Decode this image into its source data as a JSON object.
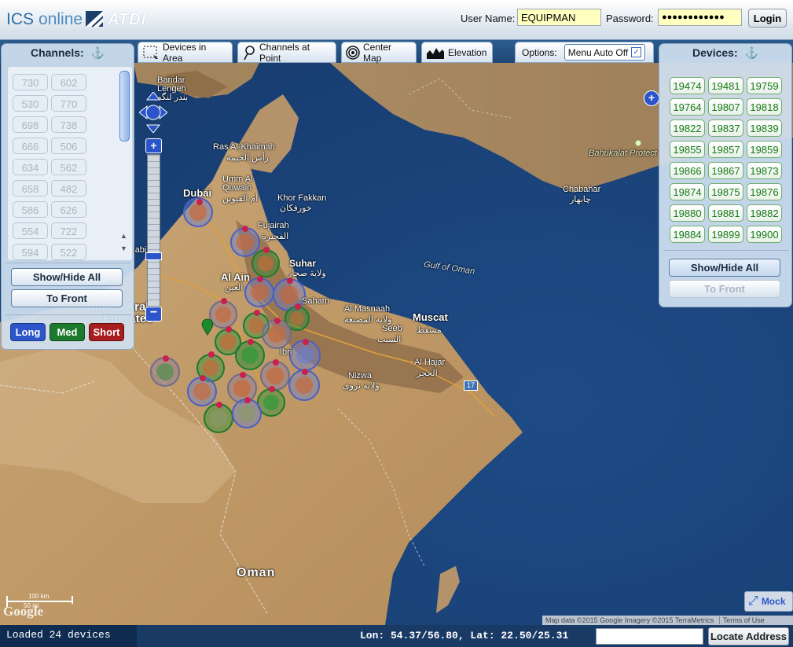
{
  "header": {
    "logo_ics": "ICS",
    "logo_online": "online",
    "logo_atdi": "ATDI",
    "username_label": "User Name:",
    "username_value": "EQUIPMAN",
    "password_label": "Password:",
    "password_value": "●●●●●●●●●●●●",
    "login_label": "Login"
  },
  "toolbar": {
    "devices_in_area": "Devices in Area",
    "channels_at_point": "Channels at Point",
    "center_map": "Center Map",
    "elevation": "Elevation",
    "options_label": "Options:",
    "menu_auto_off": "Menu Auto Off",
    "menu_auto_off_checked": true
  },
  "channels_panel": {
    "title": "Channels:",
    "channels": [
      "730",
      "602",
      "530",
      "770",
      "698",
      "738",
      "666",
      "506",
      "634",
      "562",
      "658",
      "482",
      "586",
      "626",
      "554",
      "722",
      "594",
      "522"
    ],
    "show_hide_all": "Show/Hide All",
    "to_front": "To Front",
    "range_long": "Long",
    "range_med": "Med",
    "range_short": "Short"
  },
  "devices_panel": {
    "title": "Devices:",
    "devices": [
      "19474",
      "19481",
      "19759",
      "19764",
      "19807",
      "19818",
      "19822",
      "19837",
      "19839",
      "19855",
      "19857",
      "19859",
      "19866",
      "19867",
      "19873",
      "19874",
      "19875",
      "19876",
      "19880",
      "19881",
      "19882",
      "19884",
      "19899",
      "19900"
    ],
    "show_hide_all": "Show/Hide All",
    "to_front": "To Front"
  },
  "map": {
    "labels": {
      "bandar_lengeh": "Bandar\nLengeh",
      "bandar_lengeh_ar": "بندر لنگه",
      "ras_al_khaimah": "Ras Al-Khaimah",
      "ras_al_khaimah_ar": "رأس الخيمة",
      "umm_al_quwain": "Umm Al\nQuwain",
      "umm_al_quwain_ar": "أم القيوين",
      "dubai": "Dubai",
      "khor_fakkan": "Khor Fakkan",
      "khor_fakkan_ar": "خورفكان",
      "fujairah": "Fujairah",
      "fujairah_ar": "الفجيرة",
      "suhar": "Suhar",
      "suhar_ar": "ولاية صحار",
      "al_ain": "Al Ain",
      "al_ain_ar": "العين",
      "abu_dhabi": "Abu Dhabi",
      "united_arab_emirates": "United Arab\nEmirates",
      "saham": "Saham",
      "al_masnaah": "Al Masnaah",
      "al_masnaah_ar": "ولاية المصنعة",
      "gulf_of_oman": "Gulf of Oman",
      "muscat": "Muscat",
      "muscat_ar": "مسقط",
      "seeb": "Seeb",
      "seeb_ar": "السيب",
      "ibri": "Ibri",
      "al_hajar": "Al Hajar",
      "al_hajar_ar": "الحجر",
      "nizwa": "Nizwa",
      "nizwa_ar": "ولاية نزوى",
      "chabahar": "Chabahar",
      "chabahar_ar": "چابهار",
      "bahukalat": "Bahukalat Protect",
      "oman": "Oman",
      "road_17": "17"
    },
    "scale_km": "100 km",
    "scale_mi": "50 mi",
    "attribution": "Map data ©2015 Google Imagery ©2015 TerraMetrics",
    "terms": "Terms of Use",
    "google": "Google",
    "mock_label": "Mock"
  },
  "status": {
    "loaded": "Loaded 24 devices",
    "coords": "Lon: 54.37/56.80, Lat: 22.50/25.31",
    "address_placeholder": "",
    "locate_label": "Locate Address"
  },
  "colors": {
    "long": "#2a4fb8",
    "med": "#1d7a2c",
    "short": "#a81d1d",
    "device_text": "#167a16"
  }
}
